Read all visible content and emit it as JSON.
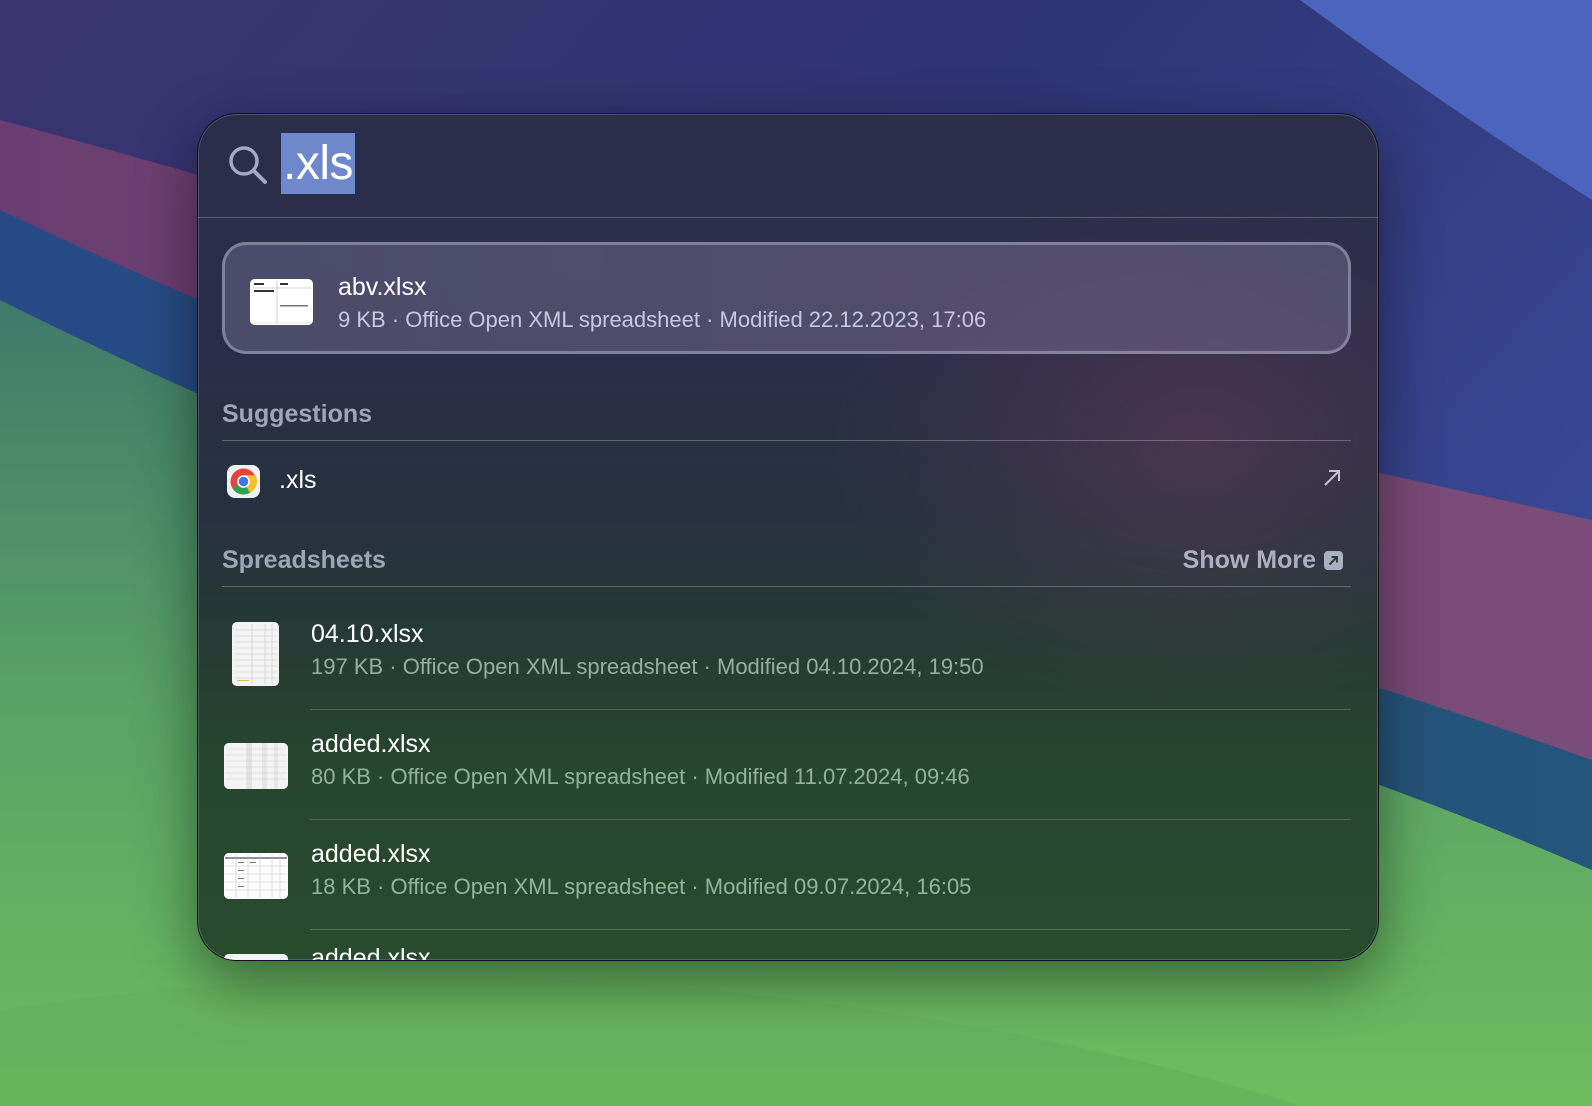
{
  "search": {
    "query": ".xls",
    "icon": "magnifying-glass"
  },
  "top_hit": {
    "name": "abv.xlsx",
    "meta": "9 KB · Office Open XML spreadsheet · Modified 22.12.2023, 17:06",
    "thumbnail_icon": "spreadsheet-thumbnail"
  },
  "sections": {
    "suggestions": {
      "label": "Suggestions",
      "items": [
        {
          "text": ".xls",
          "app_icon": "chrome-icon",
          "action_icon": "arrow-up-right"
        }
      ]
    },
    "spreadsheets": {
      "label": "Spreadsheets",
      "show_more": "Show More",
      "items": [
        {
          "name": "04.10.xlsx",
          "meta": "197 KB · Office Open XML spreadsheet · Modified 04.10.2024, 19:50"
        },
        {
          "name": "added.xlsx",
          "meta": "80 KB · Office Open XML spreadsheet · Modified 11.07.2024, 09:46"
        },
        {
          "name": "added.xlsx",
          "meta": "18 KB · Office Open XML spreadsheet · Modified 09.07.2024, 16:05"
        },
        {
          "name": "added.xlsx",
          "meta": ""
        }
      ]
    }
  },
  "colors": {
    "selection_highlight": "#6f88cc",
    "text_primary": "#ffffff",
    "section_label": "#cdd2e6"
  }
}
